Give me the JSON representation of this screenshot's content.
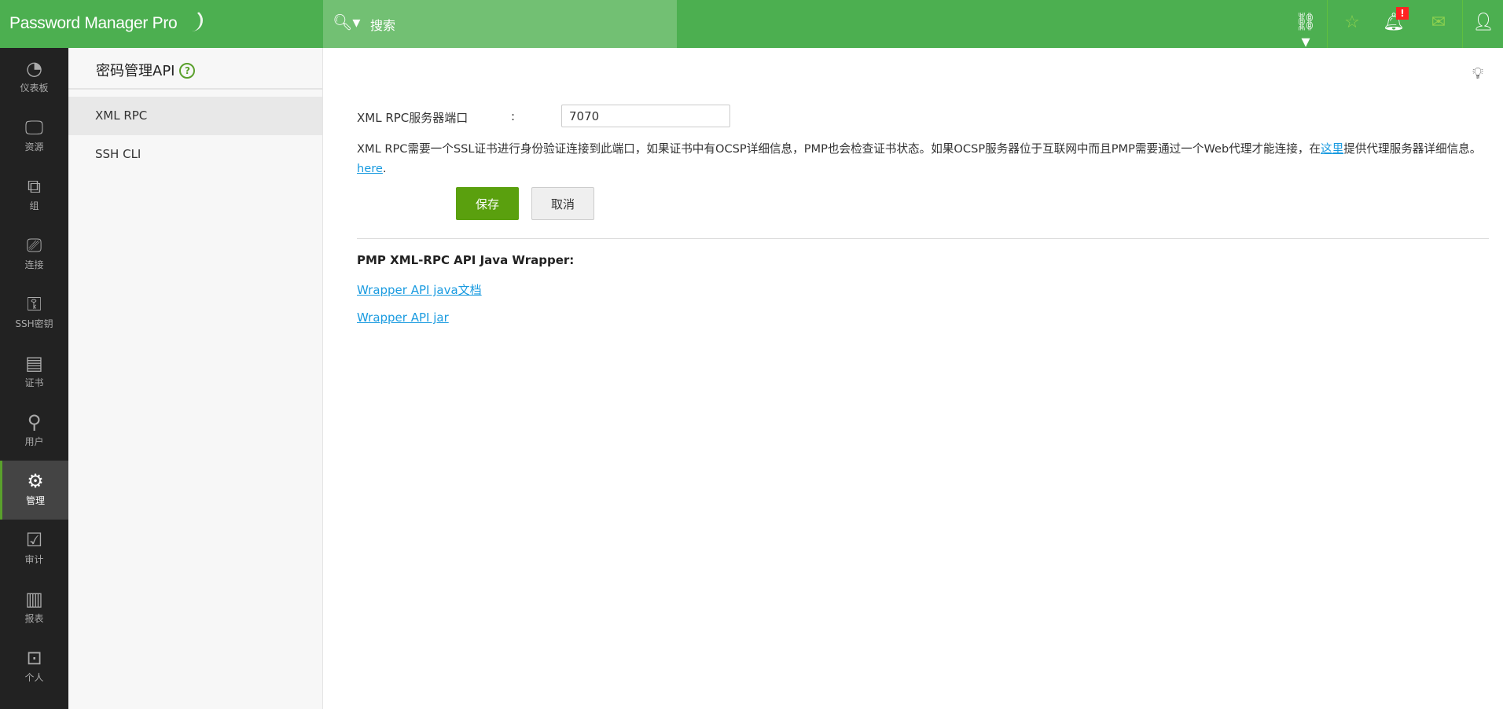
{
  "header": {
    "logo": "Password Manager Pro",
    "search_label": "搜索",
    "alert_badge": "!"
  },
  "sidebar": {
    "items": [
      {
        "label": "仪表板",
        "icon": "◔"
      },
      {
        "label": "资源",
        "icon": "🖵"
      },
      {
        "label": "组",
        "icon": "⧉"
      },
      {
        "label": "连接",
        "icon": "⎚"
      },
      {
        "label": "SSH密钥",
        "icon": "⚿"
      },
      {
        "label": "证书",
        "icon": "▤"
      },
      {
        "label": "用户",
        "icon": "⚲"
      },
      {
        "label": "管理",
        "icon": "⚙"
      },
      {
        "label": "审计",
        "icon": "☑"
      },
      {
        "label": "报表",
        "icon": "▥"
      },
      {
        "label": "个人",
        "icon": "⊡"
      }
    ],
    "active": "管理"
  },
  "subnav": {
    "title": "密码管理API",
    "help": "?",
    "items": [
      "XML RPC",
      "SSH CLI"
    ]
  },
  "form": {
    "port_label": "XML RPC服务器端口",
    "colon": ":",
    "port_value": "7070",
    "desc_1": "XML RPC需要一个SSL证书进行身份验证连接到此端口，如果证书中有OCSP详细信息，PMP也会检查证书状态。如果OCSP服务器位于互联网中而且PMP需要通过一个Web代理才能连接，在",
    "desc_link": "这里",
    "desc_2": "提供代理服务器详细信息。",
    "here_link": "here",
    "period": ".",
    "save": "保存",
    "cancel": "取消"
  },
  "wrapper": {
    "heading": "PMP XML-RPC API Java Wrapper:",
    "link_javadoc": "Wrapper API java文档",
    "link_jar": "Wrapper API jar"
  },
  "colors": {
    "header": "#4caf50",
    "search": "#72c073",
    "save": "#5aa00e",
    "link": "#1a9be0"
  }
}
